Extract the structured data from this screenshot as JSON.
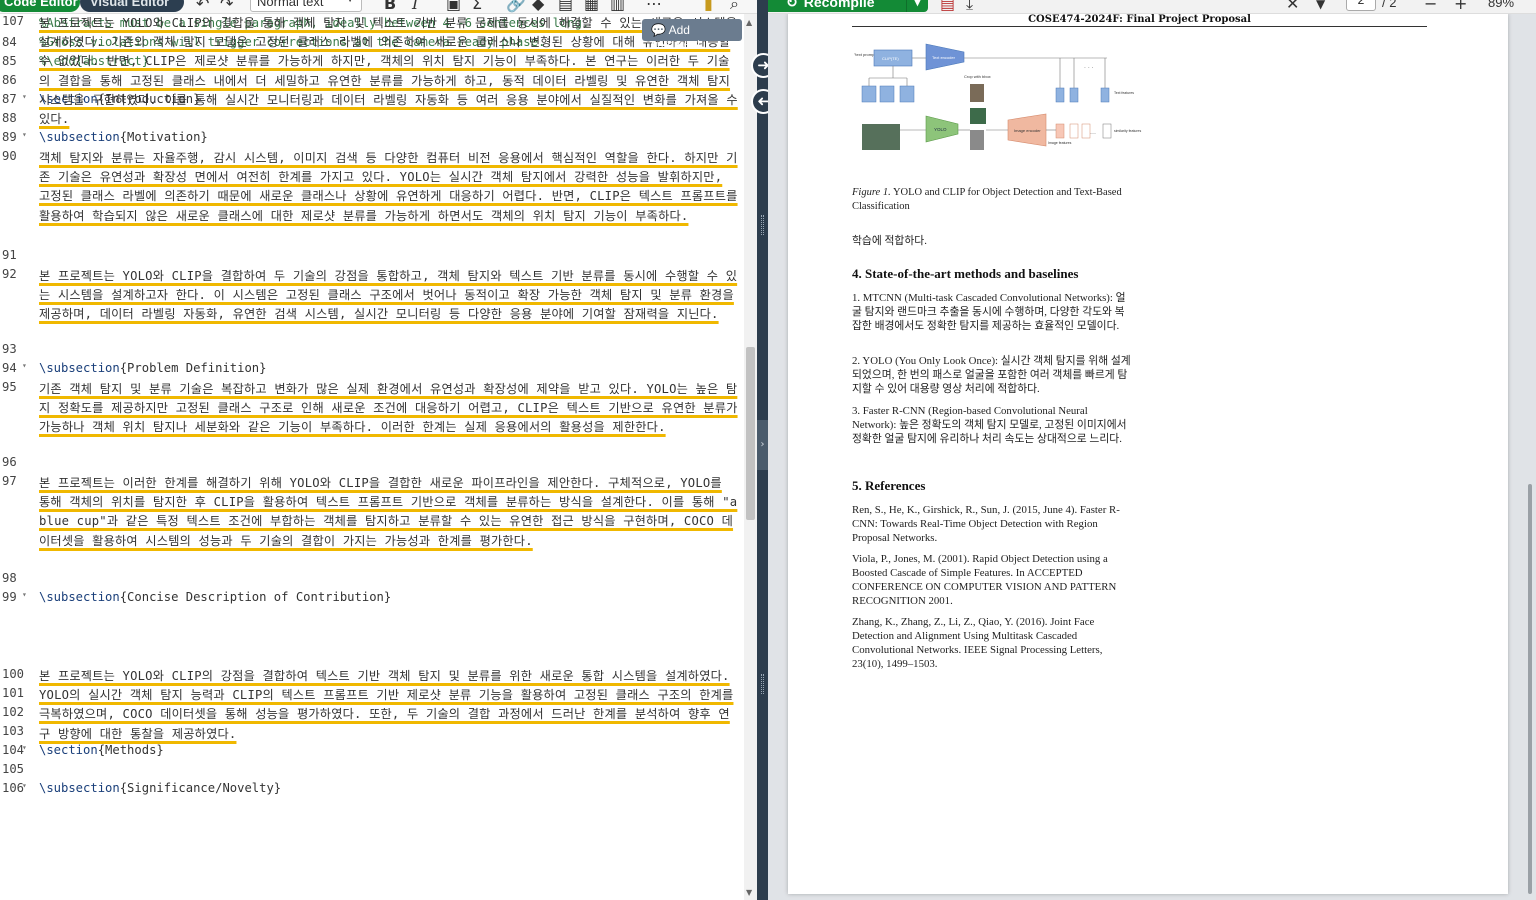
{
  "toolbar": {
    "code_editor": "Code Editor",
    "visual_editor": "Visual Editor",
    "style_select": "Normal text"
  },
  "editor": {
    "add_comment": "Add comment",
    "lines": [
      {
        "n": "",
        "text": "%Abstracts must be a single paragraph, ideally between 4--6 sentences long.",
        "type": "comment"
      },
      {
        "n": "84",
        "text": "%Gross violations will trigger corrections at the camera-ready phase.",
        "type": "comment"
      },
      {
        "n": "85",
        "text": "%\\end{abstract}",
        "type": "comment"
      },
      {
        "n": "86",
        "text": "",
        "type": "plain"
      },
      {
        "n": "87",
        "text": "{Introduction}",
        "cmd": "\\section",
        "type": "cmd"
      },
      {
        "n": "88",
        "text": "",
        "type": "plain"
      },
      {
        "n": "89",
        "text": "{Motivation}",
        "cmd": "\\subsection",
        "type": "cmd"
      },
      {
        "n": "90",
        "text": "객체 탐지와 분류는 자율주행, 감시 시스템, 이미지 검색 등 다양한 컴퓨터 비전 응용에서 핵심적인 역할을 한다. 하지만 기존 기술은 유연성과 확장성 면에서 여전히 한계를 가지고 있다. YOLO는 실시간 객체 탐지에서 강력한 성능을 발휘하지만, 고정된 클래스 라벨에 의존하기 때문에 새로운 클래스나 상황에 유연하게 대응하기 어렵다. 반면, CLIP은 텍스트 프롬프트를 활용하여 학습되지 않은 새로운 클래스에 대한 제로샷 분류를 가능하게 하면서도 객체의 위치 탐지 기능이 부족하다.",
        "type": "kr"
      },
      {
        "n": "91",
        "text": "",
        "type": "plain"
      },
      {
        "n": "92",
        "text": "본 프로젝트는 YOLO와 CLIP을 결합하여 두 기술의 강점을 통합하고, 객체 탐지와 텍스트 기반 분류를 동시에 수행할 수 있는 시스템을 설계하고자 한다. 이 시스템은 고정된 클래스 구조에서 벗어나 동적이고 확장 가능한 객체 탐지 및 분류 환경을 제공하며, 데이터 라벨링 자동화, 유연한 검색 시스템, 실시간 모니터링 등 다양한 응용 분야에 기여할 잠재력을 지닌다.",
        "type": "kr"
      },
      {
        "n": "93",
        "text": "",
        "type": "plain"
      },
      {
        "n": "94",
        "text": "{Problem Definition}",
        "cmd": "\\subsection",
        "type": "cmd"
      },
      {
        "n": "95",
        "text": "기존 객체 탐지 및 분류 기술은 복잡하고 변화가 많은 실제 환경에서 유연성과 확장성에 제약을 받고 있다. YOLO는 높은 탐지 정확도를 제공하지만 고정된 클래스 구조로 인해 새로운 조건에 대응하기 어렵고, CLIP은 텍스트 기반으로 유연한 분류가 가능하나 객체 위치 탐지나 세분화와 같은 기능이 부족하다. 이러한 한계는 실제 응용에서의 활용성을 제한한다.",
        "type": "kr"
      },
      {
        "n": "96",
        "text": "",
        "type": "plain"
      },
      {
        "n": "97",
        "text": "본 프로젝트는 이러한 한계를 해결하기 위해 YOLO와 CLIP을 결합한 새로운 파이프라인을 제안한다. 구체적으로, YOLO를 통해 객체의 위치를 탐지한 후 CLIP을 활용하여 텍스트 프롬프트 기반으로 객체를 분류하는 방식을 설계한다. 이를 통해 \"a blue cup\"과 같은 특정 텍스트 조건에 부합하는 객체를 탐지하고 분류할 수 있는 유연한 접근 방식을 구현하며, COCO 데이터셋을 활용하여 시스템의 성능과 두 기술의 결합이 가지는 가능성과 한계를 평가한다.",
        "type": "kr"
      },
      {
        "n": "98",
        "text": "",
        "type": "plain"
      },
      {
        "n": "99",
        "text": "{Concise Description of Contribution}",
        "cmd": "\\subsection",
        "type": "cmd"
      },
      {
        "n": "100",
        "text": "본 프로젝트는 YOLO와 CLIP의 강점을 결합하여 텍스트 기반 객체 탐지 및 분류를 위한 새로운 통합 시스템을 설계하였다. YOLO의 실시간 객체 탐지 능력과 CLIP의 텍스트 프롬프트 기반 제로샷 분류 기능을 활용하여 고정된 클래스 구조의 한계를 극복하였으며, COCO 데이터셋을 통해 성능을 평가하였다. 또한, 두 기술의 결합 과정에서 드러난 한계를 분석하여 향후 연구 방향에 대한 통찰을 제공하였다.",
        "type": "kr"
      },
      {
        "n": "101",
        "text": "",
        "type": "plain"
      },
      {
        "n": "102",
        "text": "",
        "type": "plain"
      },
      {
        "n": "103",
        "text": "",
        "type": "plain"
      },
      {
        "n": "104",
        "text": "{Methods}",
        "cmd": "\\section",
        "type": "cmd"
      },
      {
        "n": "105",
        "text": "",
        "type": "plain"
      },
      {
        "n": "106",
        "text": "{Significance/Novelty}",
        "cmd": "\\subsection",
        "type": "cmd"
      },
      {
        "n": "107",
        "text": "본 프로젝트는 YOLO와 CLIP의 결합을 통해 객체 탐지 및 텍스트 기반 분류 문제를 동시에 해결할 수 있는 새로운 시스템을 설계하였다. 기존의 객체 탐지 모델은 고정된 클래스 라벨에 의존하여 새로운 클래스나 변형된 상황에 대해 유연하게 대응할 수 없었다. 반면, CLIP은 제로샷 분류를 가능하게 하지만, 객체의 위치 탐지 기능이 부족하다. 본 연구는 이러한 두 기술의 결합을 통해 고정된 클래스 내에서 더 세밀하고 유연한 분류를 가능하게 하고, 동적 데이터 라벨링 및 유연한 객체 탐지 시스템을 구현하였다. 이를 통해 실시간 모니터링과 데이터 라벨링 자동화 등 여러 응용 분야에서 실질적인 변화를 가져올 수 있다.",
        "type": "kr"
      }
    ]
  },
  "pdf_toolbar": {
    "recompile": "Recompile",
    "page": "2",
    "total": "/ 2",
    "zoom": "89%"
  },
  "pdf": {
    "header": "COSE474-2024F: Final Project Proposal",
    "figure": {
      "text_prompt": "\"text prompt\"",
      "clip_box": "CLIP(TE)",
      "text_encoder": "Text encoder",
      "crop_with_bbox": "Crop with bbox",
      "yolo": "YOLO",
      "image_encoder": "Image encoder",
      "text_features": "Text features",
      "image_features": "Image features",
      "similarity_features": "similarity features"
    },
    "fig_caption_label": "Figure 1.",
    "fig_caption_text": "YOLO and CLIP for Object Detection and Text-Based Classification",
    "cont_text": "학습에 적합하다.",
    "section4_title": "4. State-of-the-art methods and baselines",
    "s4_items": [
      "1. MTCNN (Multi-task Cascaded Convolutional Networks): 얼굴 탐지와 랜드마크 추출을 동시에 수행하며, 다양한 각도와 복잡한 배경에서도 정확한 탐지를 제공하는 효율적인 모델이다.",
      "2. YOLO (You Only Look Once): 실시간 객체 탐지를 위해 설계되었으며, 한 번의 패스로 얼굴을 포함한 여러 객체를 빠르게 탐지할 수 있어 대용량 영상 처리에 적합하다.",
      "3. Faster R-CNN (Region-based Convolutional Neural Network): 높은 정확도의 객체 탐지 모델로, 고정된 이미지에서 정확한 얼굴 탐지에 유리하나 처리 속도는 상대적으로 느리다."
    ],
    "section5_title": "5. References",
    "references": [
      "Ren, S., He, K., Girshick, R., Sun, J. (2015, June 4). Faster R-CNN: Towards Real-Time Object Detection with Region Proposal Networks.",
      "Viola, P., Jones, M. (2001). Rapid Object Detection using a Boosted Cascade of Simple Features. In ACCEPTED CONFERENCE ON COMPUTER VISION AND PATTERN RECOGNITION 2001.",
      "Zhang, K., Zhang, Z., Li, Z., Qiao, Y. (2016). Joint Face Detection and Alignment Using Multitask Cascaded Convolutional Networks. IEEE Signal Processing Letters, 23(10), 1499–1503."
    ]
  },
  "colors": {
    "accent_green": "#138a36",
    "splitter": "#2d3d4d",
    "spell_underline": "#f0b800",
    "comment_text": "#3a7b4a"
  }
}
